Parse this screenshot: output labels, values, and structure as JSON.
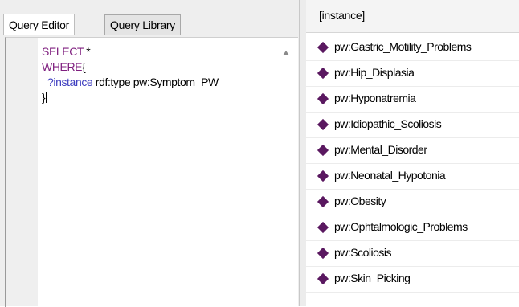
{
  "tabs": [
    {
      "label": "Query Editor",
      "active": true
    },
    {
      "label": "Query Library",
      "active": false
    }
  ],
  "editor": {
    "lines": [
      {
        "parts": [
          {
            "text": "SELECT",
            "kind": "keyword"
          },
          {
            "text": " *",
            "kind": "plain"
          }
        ]
      },
      {
        "parts": [
          {
            "text": "WHERE",
            "kind": "keyword"
          },
          {
            "text": "{",
            "kind": "plain"
          }
        ]
      },
      {
        "parts": [
          {
            "text": "  ?instance",
            "kind": "variable"
          },
          {
            "text": " rdf:type pw:Symptom_PW",
            "kind": "plain"
          }
        ]
      },
      {
        "parts": [
          {
            "text": "}",
            "kind": "plain"
          }
        ]
      }
    ],
    "keyword_color": "#7f1f7f",
    "variable_color": "#4040c0"
  },
  "results": {
    "column_header": "[instance]",
    "icon": "individual-diamond-icon",
    "icon_color": "#5a1860",
    "rows": [
      "pw:Gastric_Motility_Problems",
      "pw:Hip_Displasia",
      "pw:Hyponatremia",
      "pw:Idiopathic_Scoliosis",
      "pw:Mental_Disorder",
      "pw:Neonatal_Hypotonia",
      "pw:Obesity",
      "pw:Ophtalmologic_Problems",
      "pw:Scoliosis",
      "pw:Skin_Picking"
    ]
  }
}
